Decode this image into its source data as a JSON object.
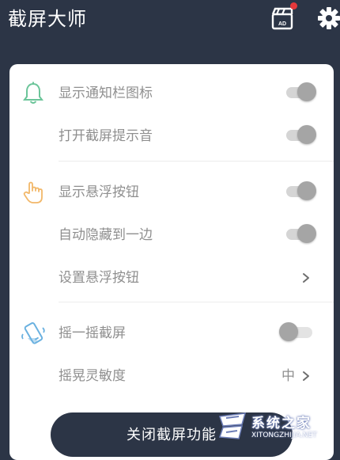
{
  "header": {
    "title": "截屏大师",
    "ad_icon": "ad-clapperboard-icon",
    "ad_badge_label": "AD",
    "settings_icon": "gear-icon"
  },
  "settings": {
    "notification_section": {
      "icon": "bell-icon",
      "show_notification_icon": {
        "label": "显示通知栏图标",
        "enabled": true
      },
      "screenshot_sound": {
        "label": "打开截屏提示音",
        "enabled": true
      }
    },
    "float_section": {
      "icon": "hand-pointer-icon",
      "show_float_button": {
        "label": "显示悬浮按钮",
        "enabled": true
      },
      "auto_hide_edge": {
        "label": "自动隐藏到一边",
        "enabled": true
      },
      "float_button_settings": {
        "label": "设置悬浮按钮"
      }
    },
    "shake_section": {
      "icon": "shake-phone-icon",
      "shake_screenshot": {
        "label": "摇一摇截屏",
        "enabled": false
      },
      "shake_sensitivity": {
        "label": "摇晃灵敏度",
        "value": "中"
      }
    }
  },
  "actions": {
    "close_screenshot_label": "关闭截屏功能"
  },
  "watermark": {
    "text": "系统之家",
    "sub": "XITONGZHIJIA.NET"
  },
  "colors": {
    "header_bg": "#2c3546",
    "card_bg": "#ffffff",
    "bell": "#6cc59a",
    "hand": "#f2b86a",
    "phone": "#6ab1e0",
    "toggle_knob": "#a5a5a5",
    "toggle_track": "#d5d5d5"
  }
}
